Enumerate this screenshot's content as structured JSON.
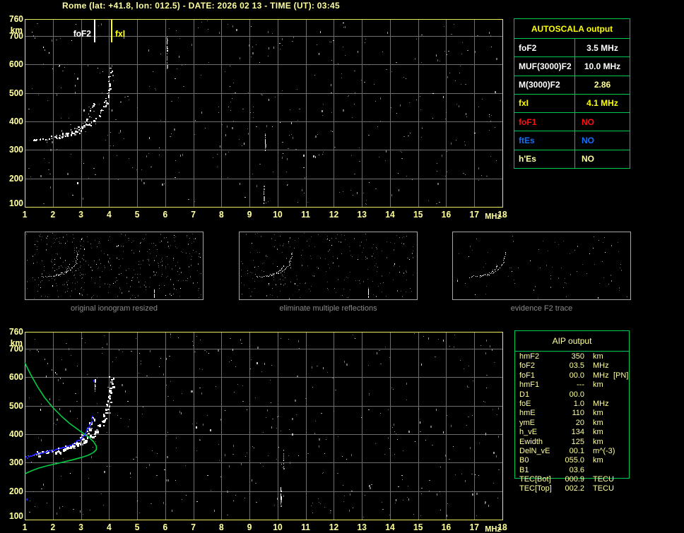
{
  "title": "Rome (lat: +41.8, lon: 012.5) - DATE: 2026 02 13 - TIME (UT): 03:45",
  "colors": {
    "background": "#000000",
    "pale_yellow": "#FFFF9C",
    "yellow": "#FFFF00",
    "white": "#FFFFFF",
    "red": "#FF1010",
    "blue": "#1070FF",
    "green": "#00C850",
    "grid_gray": "#6E6E6E",
    "frame_yellow": "#E9E95A",
    "noise_gray": "#9A9A9A",
    "profile_green": "#00CC44",
    "fitted_blue": "#2222FF",
    "caption_gray": "#8A8A8A",
    "thumb_border": "#A8A8A8"
  },
  "autoscala": {
    "header": "AUTOSCALA output",
    "rows": [
      {
        "label": "foF2",
        "value": "3.5 MHz",
        "label_color": "#FFFFFF",
        "value_color": "#FFFFFF"
      },
      {
        "label": "MUF(3000)F2",
        "value": "10.0 MHz",
        "label_color": "#FFFFFF",
        "value_color": "#FFFFFF"
      },
      {
        "label": "M(3000)F2",
        "value": "2.86",
        "label_color": "#FFFFFF",
        "value_color": "#FFFF9C"
      },
      {
        "label": "fxI",
        "value": "4.1 MHz",
        "label_color": "#FFFF00",
        "value_color": "#FFFF00"
      },
      {
        "label": "foF1",
        "value": "NO",
        "label_color": "#FF1010",
        "value_color": "#FF1010"
      },
      {
        "label": "ftEs",
        "value": "NO",
        "label_color": "#1070FF",
        "value_color": "#1070FF"
      },
      {
        "label": "h'Es",
        "value": "NO",
        "label_color": "#FFFF9C",
        "value_color": "#FFFF9C"
      }
    ]
  },
  "aip": {
    "header": "AIP output",
    "rows": [
      {
        "label": "hmF2",
        "value": "350",
        "unit": "km",
        "extra": ""
      },
      {
        "label": "foF2",
        "value": "03.5",
        "unit": "MHz",
        "extra": ""
      },
      {
        "label": "foF1",
        "value": "00.0",
        "unit": "MHz",
        "extra": "[PN]"
      },
      {
        "label": "hmF1",
        "value": "---",
        "unit": "km",
        "extra": ""
      },
      {
        "label": "D1",
        "value": "00.0",
        "unit": "",
        "extra": ""
      },
      {
        "label": "foE",
        "value": "1.0",
        "unit": "MHz",
        "extra": ""
      },
      {
        "label": "hmE",
        "value": "110",
        "unit": "km",
        "extra": ""
      },
      {
        "label": "ymE",
        "value": "20",
        "unit": "km",
        "extra": ""
      },
      {
        "label": "h_vE",
        "value": "134",
        "unit": "km",
        "extra": ""
      },
      {
        "label": "Ewidth",
        "value": "125",
        "unit": "km",
        "extra": ""
      },
      {
        "label": "DelN_vE",
        "value": "00.1",
        "unit": "m^(-3)",
        "extra": ""
      },
      {
        "label": "B0",
        "value": "055.0",
        "unit": "km",
        "extra": ""
      },
      {
        "label": "B1",
        "value": "03.6",
        "unit": "",
        "extra": ""
      },
      {
        "label": "TEC[Bot]",
        "value": "000.9",
        "unit": "TECU",
        "extra": ""
      },
      {
        "label": "TEC[Top]",
        "value": "002.2",
        "unit": "TECU",
        "extra": ""
      }
    ]
  },
  "thumbnails": [
    {
      "caption": "original ionogram resized",
      "noise_seed": 3,
      "noise_count": 380,
      "streaks": [
        [
          10.2,
          130,
          210
        ]
      ]
    },
    {
      "caption": "eliminate multiple reflections",
      "noise_seed": 5,
      "noise_count": 230,
      "streaks": [
        [
          10.2,
          130,
          210
        ]
      ]
    },
    {
      "caption": "evidence F2 trace",
      "noise_seed": 9,
      "noise_count": 80,
      "streaks": []
    }
  ],
  "thumb_view": {
    "xlim": [
      0,
      14
    ],
    "ylim": [
      100,
      800
    ]
  },
  "chart_data": [
    {
      "name": "scaled ionogram with foF2 and fxI markers",
      "type": "scatter",
      "xlabel": "MHz",
      "ylabel": "km",
      "xlim": [
        1,
        18
      ],
      "ylim": [
        100,
        760
      ],
      "xticks": [
        1,
        2,
        3,
        4,
        5,
        6,
        7,
        8,
        9,
        10,
        11,
        12,
        13,
        14,
        15,
        16,
        17,
        18
      ],
      "yticks": [
        760,
        700,
        600,
        500,
        400,
        300,
        200,
        100
      ],
      "grid": true,
      "markers": [
        {
          "label": "foF2",
          "freq_mhz": 3.5,
          "color": "#FFFFFF"
        },
        {
          "label": "fxI",
          "freq_mhz": 4.1,
          "color": "#FFFF00"
        }
      ],
      "o_trace": [
        [
          1.25,
          332
        ],
        [
          1.5,
          336
        ],
        [
          1.75,
          340
        ],
        [
          2.0,
          345
        ],
        [
          2.25,
          351
        ],
        [
          2.5,
          359
        ],
        [
          2.75,
          369
        ],
        [
          2.95,
          381
        ],
        [
          3.1,
          394
        ],
        [
          3.2,
          409
        ],
        [
          3.3,
          428
        ],
        [
          3.38,
          450
        ],
        [
          3.44,
          470
        ]
      ],
      "x_trace": [
        [
          2.1,
          342
        ],
        [
          2.4,
          350
        ],
        [
          2.7,
          360
        ],
        [
          2.95,
          371
        ],
        [
          3.2,
          386
        ],
        [
          3.45,
          404
        ],
        [
          3.62,
          424
        ],
        [
          3.76,
          446
        ],
        [
          3.87,
          470
        ],
        [
          3.95,
          497
        ],
        [
          4.0,
          526
        ],
        [
          4.04,
          556
        ],
        [
          4.07,
          584
        ],
        [
          4.09,
          606
        ]
      ],
      "noise_seed": 7,
      "noise_count": 420,
      "streaks": [
        [
          6.05,
          590,
          700
        ],
        [
          9.55,
          300,
          360
        ],
        [
          9.5,
          115,
          175
        ]
      ],
      "diag_cluster": [
        [
          1.3,
          705
        ],
        [
          2.4,
          575
        ]
      ]
    },
    {
      "name": "ionogram with restored electron density profile",
      "type": "scatter",
      "xlabel": "MHz",
      "ylabel": "km",
      "xlim": [
        1,
        18
      ],
      "ylim": [
        100,
        760
      ],
      "xticks": [
        1,
        2,
        3,
        4,
        5,
        6,
        7,
        8,
        9,
        10,
        11,
        12,
        13,
        14,
        15,
        16,
        17,
        18
      ],
      "yticks": [
        760,
        700,
        600,
        500,
        400,
        300,
        200,
        100
      ],
      "grid": true,
      "o_trace": [
        [
          1.25,
          330
        ],
        [
          1.5,
          334
        ],
        [
          1.75,
          338
        ],
        [
          2.0,
          343
        ],
        [
          2.25,
          349
        ],
        [
          2.5,
          357
        ],
        [
          2.75,
          367
        ],
        [
          2.95,
          379
        ],
        [
          3.1,
          392
        ],
        [
          3.2,
          407
        ],
        [
          3.3,
          426
        ],
        [
          3.38,
          448
        ],
        [
          3.44,
          470
        ]
      ],
      "x_trace": [
        [
          2.1,
          340
        ],
        [
          2.4,
          348
        ],
        [
          2.7,
          358
        ],
        [
          2.95,
          369
        ],
        [
          3.2,
          384
        ],
        [
          3.45,
          402
        ],
        [
          3.62,
          422
        ],
        [
          3.76,
          444
        ],
        [
          3.87,
          468
        ],
        [
          3.95,
          495
        ],
        [
          4.0,
          524
        ],
        [
          4.04,
          554
        ],
        [
          4.07,
          582
        ],
        [
          4.09,
          604
        ]
      ],
      "profile": [
        [
          1.0,
          652
        ],
        [
          1.2,
          612
        ],
        [
          1.45,
          568
        ],
        [
          1.7,
          530
        ],
        [
          2.0,
          494
        ],
        [
          2.3,
          464
        ],
        [
          2.6,
          438
        ],
        [
          2.85,
          420
        ],
        [
          3.1,
          402
        ],
        [
          3.3,
          388
        ],
        [
          3.45,
          374
        ],
        [
          3.55,
          358
        ],
        [
          3.55,
          346
        ],
        [
          3.45,
          336
        ],
        [
          3.25,
          326
        ],
        [
          3.0,
          318
        ],
        [
          2.7,
          310
        ],
        [
          2.4,
          303
        ],
        [
          2.1,
          296
        ],
        [
          1.8,
          289
        ],
        [
          1.5,
          281
        ],
        [
          1.25,
          272
        ],
        [
          1.05,
          263
        ],
        [
          1.0,
          259
        ]
      ],
      "fitted_trace": [
        [
          1.05,
          318
        ],
        [
          1.25,
          326
        ],
        [
          1.5,
          332
        ],
        [
          1.75,
          338
        ],
        [
          2.0,
          343
        ],
        [
          2.25,
          349
        ],
        [
          2.5,
          357
        ],
        [
          2.75,
          367
        ],
        [
          2.95,
          379
        ],
        [
          3.1,
          392
        ],
        [
          3.2,
          407
        ],
        [
          3.3,
          426
        ],
        [
          3.38,
          448
        ],
        [
          3.44,
          468
        ]
      ],
      "fitted_extra": [
        [
          3.46,
          590
        ],
        [
          1.08,
          172
        ]
      ],
      "noise_seed": 13,
      "noise_count": 420,
      "streaks": [
        [
          10.2,
          280,
          345
        ],
        [
          10.1,
          150,
          215
        ],
        [
          3.5,
          555,
          600
        ]
      ],
      "diag_cluster": [
        [
          1.4,
          700
        ],
        [
          2.5,
          570
        ]
      ]
    }
  ]
}
